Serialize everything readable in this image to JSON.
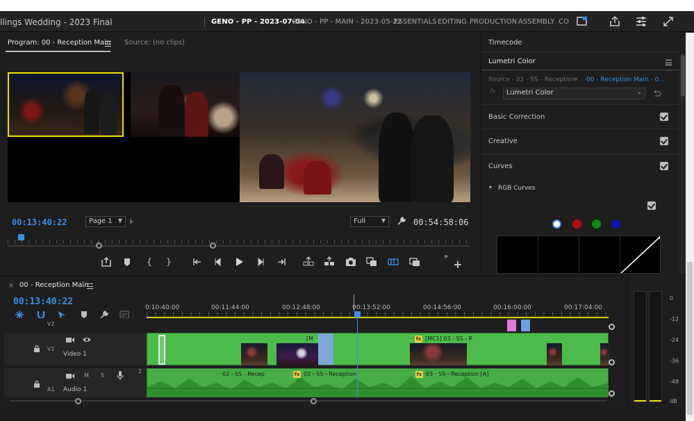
{
  "workspace": {
    "project_title": "llings Wedding - 2023 Final",
    "tabs": [
      {
        "label": "GENO - PP - 2023-07-04",
        "active": true
      },
      {
        "label": "GENO - PP - MAIN - 2023-05-22",
        "active": false
      },
      {
        "label": "ESSENTIALS",
        "active": false
      },
      {
        "label": "EDITING",
        "active": false
      },
      {
        "label": "PRODUCTION",
        "active": false
      },
      {
        "label": "ASSEMBLY",
        "active": false
      },
      {
        "label": "CO",
        "active": false
      }
    ],
    "icons": [
      "quick-export-icon",
      "share-icon",
      "settings-sliders-icon",
      "fullscreen-icon"
    ]
  },
  "program_monitor": {
    "tabs": [
      {
        "label": "Program: 00 - Reception Main",
        "active": true
      },
      {
        "label": "Source: (no clips)",
        "active": false
      }
    ],
    "current_timecode": "00:13:40:22",
    "page_select": "Page 1",
    "resolution": "Full",
    "duration": "00:54:58:06",
    "transport_buttons": [
      "export-frame",
      "add-marker",
      "mark-in",
      "mark-out",
      "go-to-in",
      "step-back",
      "play",
      "step-forward",
      "go-to-out",
      "lift",
      "extract",
      "export-frame-camera",
      "comparison-view",
      "multi-camera",
      "toggle-proxies",
      "more",
      "add-button"
    ]
  },
  "lumetri": {
    "timecode_tab": "Timecode",
    "title": "Lumetri Color",
    "source_label": "Source - 02 - SS - Reception",
    "sequence_label": "00 - Reception Main - 0...",
    "effect": "Lumetri Color",
    "sections": [
      {
        "label": "Basic Correction",
        "checked": true
      },
      {
        "label": "Creative",
        "checked": true
      },
      {
        "label": "Curves",
        "checked": true
      }
    ],
    "subsection": {
      "label": "RGB Curves",
      "checked": true
    },
    "channels": [
      {
        "name": "white",
        "color": "#ffffff",
        "selected": true
      },
      {
        "name": "red",
        "color": "#b01010",
        "selected": false
      },
      {
        "name": "green",
        "color": "#108a10",
        "selected": false
      },
      {
        "name": "blue",
        "color": "#1414b8",
        "selected": false
      }
    ]
  },
  "timeline": {
    "sequence_name": "00 - Reception Main",
    "current_timecode": "00:13:40:22",
    "ruler_labels": [
      "0:10:40:00",
      "00:11:44:00",
      "00:12:48:00",
      "00:13:52:00",
      "00:14:56:00",
      "00:16:00:00",
      "00:17:04:00"
    ],
    "tracks": [
      {
        "id": "V2",
        "name": ""
      },
      {
        "id": "V1",
        "name": "Video 1"
      },
      {
        "id": "A1",
        "name": "Audio 1",
        "mute": "M",
        "solo": "S",
        "number": "2"
      }
    ],
    "video_clip_labels": [
      "[M",
      "[MC1] 03 - SS - R"
    ],
    "audio_clip_labels": [
      "02 - SS - Recep",
      "02 - SS - Reception",
      "03 - SS - Reception [A]"
    ],
    "fx_badge": "fx"
  },
  "audio_meter": {
    "scale": [
      "0",
      "-12",
      "-24",
      "-36",
      "-48",
      "dB"
    ]
  },
  "colors": {
    "accent_blue": "#3d8fe6",
    "clip_green": "#4cbb4c",
    "selection_yellow": "#e8e000"
  }
}
